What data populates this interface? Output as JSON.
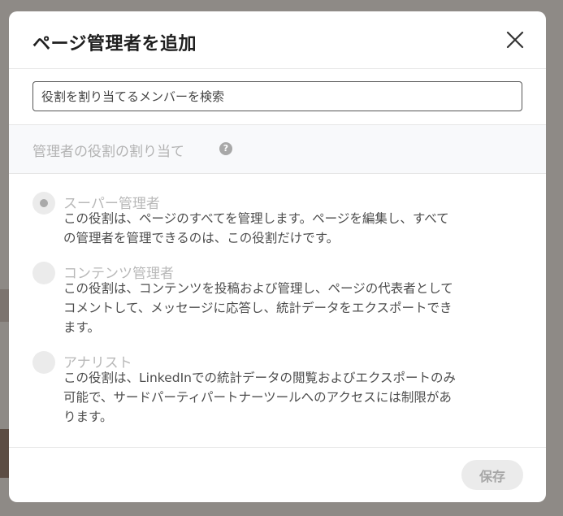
{
  "dialog": {
    "title": "ページ管理者を追加",
    "close_label": "×"
  },
  "search": {
    "placeholder": "役割を割り当てるメンバーを検索",
    "value": ""
  },
  "section": {
    "title": "管理者の役割の割り当て",
    "help_icon": "question-circle-icon",
    "help_glyph": "?"
  },
  "roles": [
    {
      "name": "スーパー管理者",
      "desc_lines": [
        "この役割は、ページのすべてを管理します。ページを編集し、すべて",
        "の管理者を管理できるのは、この役割だけです。"
      ],
      "selected": true
    },
    {
      "name": "コンテンツ管理者",
      "desc_lines": [
        "この役割は、コンテンツを投稿および管理し、ページの代表者として",
        "コメントして、メッセージに応答し、統計データをエクスポートでき",
        "ます。"
      ],
      "selected": false
    },
    {
      "name": "アナリスト",
      "desc_lines": [
        "この役割は、LinkedInでの統計データの閲覧およびエクスポートのみ",
        "可能で、サードパーティパートナーツールへのアクセスには制限があ",
        "ります。"
      ],
      "selected": false
    }
  ],
  "footer": {
    "save_label": "保存"
  },
  "colors": {
    "backdrop": "#8e8a86",
    "text_primary": "#1f1f1f",
    "text_muted": "#b8b8b8",
    "text_body": "#4d4d4d",
    "button_disabled_bg": "#ebebeb",
    "button_disabled_text": "#a6a6a6"
  }
}
